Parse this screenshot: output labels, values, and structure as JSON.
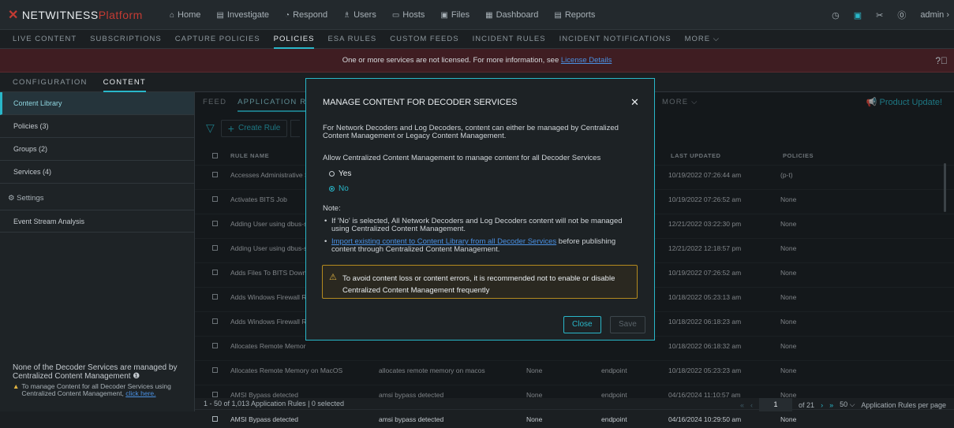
{
  "app": {
    "logo_a": "NETWITNESS",
    "logo_b": "Platform"
  },
  "topnav": [
    {
      "icon": "home-icon",
      "glyph": "⌂",
      "label": "Home"
    },
    {
      "icon": "investigate-icon",
      "glyph": "▤",
      "label": "Investigate"
    },
    {
      "icon": "respond-icon",
      "glyph": "◔",
      "label": "Respond"
    },
    {
      "icon": "users-icon",
      "glyph": "♗",
      "label": "Users"
    },
    {
      "icon": "hosts-icon",
      "glyph": "▭",
      "label": "Hosts"
    },
    {
      "icon": "files-icon",
      "glyph": "▣",
      "label": "Files"
    },
    {
      "icon": "dashboard-icon",
      "glyph": "▦",
      "label": "Dashboard"
    },
    {
      "icon": "reports-icon",
      "glyph": "▤",
      "label": "Reports"
    }
  ],
  "topright": {
    "user": "admin ›"
  },
  "subnav": [
    "LIVE CONTENT",
    "SUBSCRIPTIONS",
    "CAPTURE POLICIES",
    "POLICIES",
    "ESA RULES",
    "CUSTOM FEEDS",
    "INCIDENT RULES",
    "INCIDENT NOTIFICATIONS",
    "MORE ⌵"
  ],
  "banner": {
    "text": "One or more services are not licensed. For more information, see ",
    "link": "License Details"
  },
  "tabs2": [
    "CONFIGURATION",
    "CONTENT"
  ],
  "sidebar": {
    "items": [
      "Content Library",
      "Policies (3)",
      "Groups (2)",
      "Services (4)"
    ],
    "settings": "⚙ Settings",
    "event_stream": "Event Stream Analysis",
    "msg1": "None of the Decoder Services are managed by Centralized Content Management ❶",
    "msg2": "To manage Content for all Decoder Services using Centralized Content Management, ",
    "msg2_link": "click here."
  },
  "feedtabs": {
    "feed": "FEED",
    "app": "APPLICATION RU",
    "more": "MORE ⌵",
    "product_update": "📢 Product Update!"
  },
  "toolbar": {
    "create": "Create Rule"
  },
  "table": {
    "headers": [
      "RULE NAME",
      "LAST UPDATED",
      "POLICIES"
    ],
    "rows": [
      {
        "name": "Accesses Administrative S",
        "desc": "",
        "sev": "",
        "cat": "",
        "upd": "10/19/2022 07:26:44 am",
        "pol": "(p-t)"
      },
      {
        "name": "Activates BITS Job",
        "desc": "",
        "sev": "",
        "cat": "",
        "upd": "10/19/2022 07:26:52 am",
        "pol": "None"
      },
      {
        "name": "Adding User using dbus-s",
        "desc": "",
        "sev": "",
        "cat": "",
        "upd": "12/21/2022 03:22:30 pm",
        "pol": "None"
      },
      {
        "name": "Adding User using dbus-s",
        "desc": "",
        "sev": "",
        "cat": "",
        "upd": "12/21/2022 12:18:57 pm",
        "pol": "None"
      },
      {
        "name": "Adds Files To BITS Downl",
        "desc": "",
        "sev": "",
        "cat": "",
        "upd": "10/19/2022 07:26:52 am",
        "pol": "None"
      },
      {
        "name": "Adds Windows Firewall R",
        "desc": "",
        "sev": "",
        "cat": "",
        "upd": "10/18/2022 05:23:13 am",
        "pol": "None"
      },
      {
        "name": "Adds Windows Firewall R",
        "desc": "",
        "sev": "",
        "cat": "",
        "upd": "10/18/2022 06:18:23 am",
        "pol": "None"
      },
      {
        "name": "Allocates Remote Memor",
        "desc": "",
        "sev": "",
        "cat": "",
        "upd": "10/18/2022 06:18:32 am",
        "pol": "None"
      },
      {
        "name": "Allocates Remote Memory on MacOS",
        "desc": "allocates remote memory on macos",
        "sev": "None",
        "cat": "endpoint",
        "upd": "10/18/2022 05:23:23 am",
        "pol": "None"
      },
      {
        "name": "AMSI Bypass detected",
        "desc": "amsi bypass detected",
        "sev": "None",
        "cat": "endpoint",
        "upd": "04/16/2024 11:10:57 am",
        "pol": "None"
      },
      {
        "name": "AMSI Bypass detected",
        "desc": "amsi bypass detected",
        "sev": "None",
        "cat": "endpoint",
        "upd": "04/16/2024 10:29:50 am",
        "pol": "None"
      }
    ]
  },
  "footer": {
    "count": "1 - 50 of 1,013 Application Rules | 0 selected",
    "page": "1",
    "of": "of 21",
    "per": "50 ⌵",
    "per_label": "Application Rules per page"
  },
  "modal": {
    "title": "MANAGE CONTENT FOR DECODER SERVICES",
    "intro": "For Network Decoders and Log Decoders, content can either be managed by Centralized Content Management or Legacy Content Management.",
    "question": "Allow Centralized Content Management to manage content for all Decoder Services",
    "yes": "Yes",
    "no": "No",
    "note": "Note:",
    "bullet1": "If 'No' is selected, All Network Decoders and Log Decoders content will not be managed using Centralized Content Management.",
    "bullet2_link": "Import existing content to Content Library from all Decoder Services",
    "bullet2_rest": " before publishing content through Centralized Content Management.",
    "warning": "To avoid content loss or content errors, it is recommended not to enable or disable Centralized Content Management frequently",
    "close": "Close",
    "save": "Save"
  },
  "colors": {
    "accent": "#29b7c9",
    "brand": "#c43b33",
    "warning": "#e0b341"
  }
}
